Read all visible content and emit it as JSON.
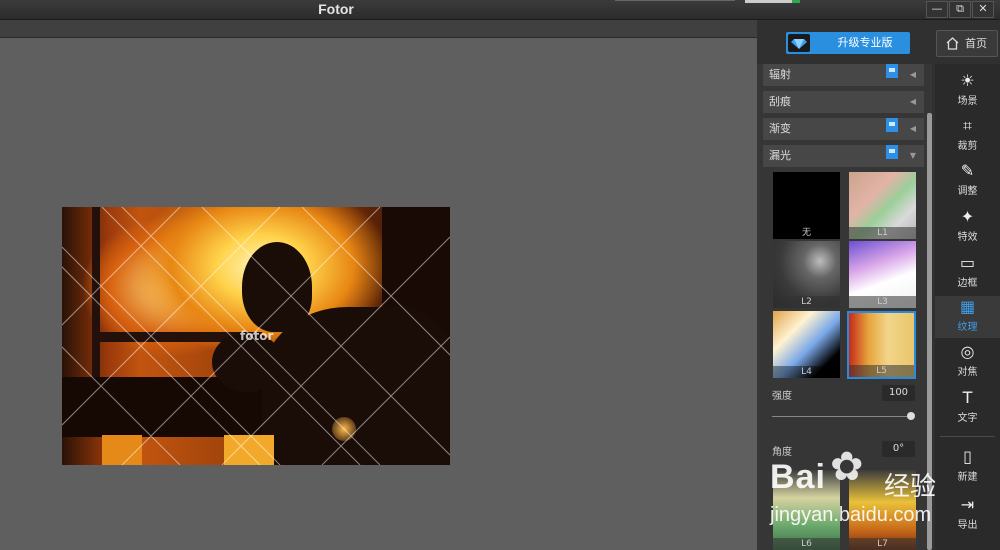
{
  "window": {
    "title": "Fotor",
    "controls": [
      "—",
      "⧉",
      "✕"
    ]
  },
  "header": {
    "upgrade_label": "升级专业版",
    "home_label": "首页"
  },
  "photo": {
    "watermark": "fotor"
  },
  "accordion": [
    {
      "label": "辐射",
      "premium": true
    },
    {
      "label": "刮痕",
      "premium": false
    },
    {
      "label": "渐变",
      "premium": true
    },
    {
      "label": "漏光",
      "premium": true
    }
  ],
  "light_leaks": [
    {
      "label": "无"
    },
    {
      "label": "L1"
    },
    {
      "label": "L2"
    },
    {
      "label": "L3"
    },
    {
      "label": "L4"
    },
    {
      "label": "L5",
      "selected": true
    },
    {
      "label": "L6"
    },
    {
      "label": "L7"
    }
  ],
  "controls": {
    "strength_label": "强度",
    "strength_value": "100",
    "angle_label": "角度",
    "angle_value": "0°"
  },
  "tools": [
    {
      "label": "场景",
      "icon": "sun-icon"
    },
    {
      "label": "裁剪",
      "icon": "crop-icon"
    },
    {
      "label": "调整",
      "icon": "brush-icon"
    },
    {
      "label": "特效",
      "icon": "sparkles-icon"
    },
    {
      "label": "边框",
      "icon": "frame-icon"
    },
    {
      "label": "纹理",
      "icon": "texture-icon",
      "active": true
    },
    {
      "label": "对焦",
      "icon": "focus-icon"
    },
    {
      "label": "文字",
      "icon": "text-icon"
    },
    {
      "label": "新建",
      "icon": "new-file-icon"
    },
    {
      "label": "导出",
      "icon": "export-icon"
    }
  ],
  "watermark_overlay": {
    "brand": "Bai",
    "brand2": "经验",
    "url": "jingyan.baidu.com"
  },
  "colors": {
    "accent": "#2b8fe0",
    "panel": "#303030",
    "canvas": "#5f5f5f"
  }
}
